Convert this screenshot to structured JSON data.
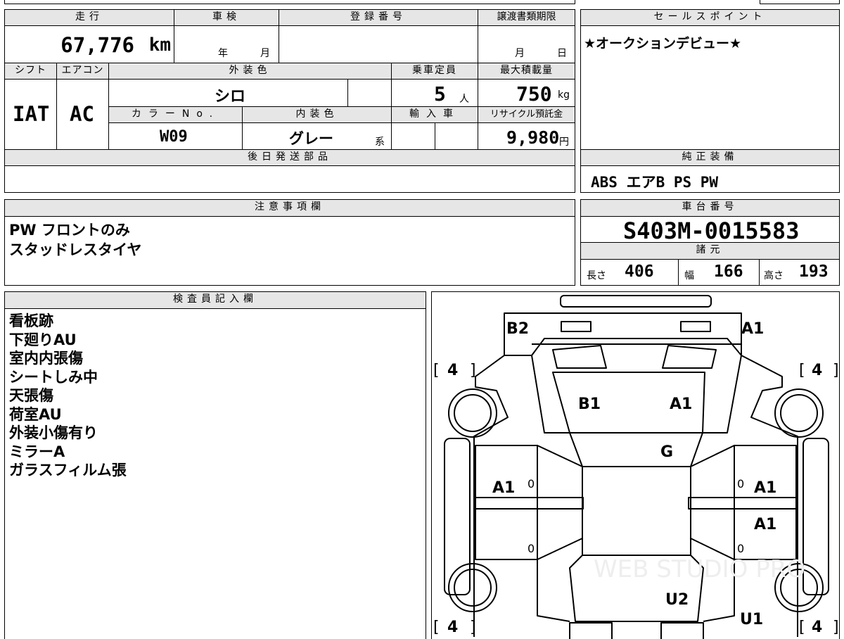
{
  "vehicle": {
    "mileage_label": "走行",
    "mileage_value": "67,776",
    "mileage_unit": "km",
    "inspection_label": "車検",
    "inspection_year_unit": "年",
    "inspection_month_unit": "月",
    "registration_label": "登録番号",
    "transfer_deadline_label": "譲渡書類期限",
    "transfer_month_unit": "月",
    "transfer_day_unit": "日",
    "shift_label": "シフト",
    "shift_value": "IAT",
    "aircon_label": "エアコン",
    "aircon_value": "AC",
    "exterior_color_label": "外装色",
    "exterior_color_value": "シロ",
    "capacity_label": "乗車定員",
    "capacity_value": "5",
    "capacity_unit": "人",
    "max_load_label": "最大積載量",
    "max_load_value": "750",
    "max_load_unit": "kg",
    "color_no_label": "カラーNo.",
    "color_no_value": "W09",
    "interior_color_label": "内装色",
    "interior_color_value": "グレー",
    "interior_color_suffix": "系",
    "import_label": "輸入車",
    "recycle_label": "リサイクル預託金",
    "recycle_value": "9,980",
    "recycle_unit": "円",
    "later_parts_label": "後日発送部品"
  },
  "sales": {
    "label": "セールスポイント",
    "text": "★オークションデビュー★"
  },
  "genuine": {
    "label": "純正装備",
    "text": "ABS エアB PS PW"
  },
  "notes": {
    "label": "注意事項欄",
    "lines": [
      "PW フロントのみ",
      "スタッドレスタイヤ"
    ]
  },
  "chassis": {
    "label": "車台番号",
    "value": "S403M-0015583",
    "spec_label": "諸元",
    "length_label": "長さ",
    "length_value": "406",
    "width_label": "幅",
    "width_value": "166",
    "height_label": "高さ",
    "height_value": "193"
  },
  "inspector": {
    "label": "検査員記入欄",
    "lines": [
      "看板跡",
      "下廻りAU",
      "室内内張傷",
      "シートしみ中",
      "天張傷",
      "荷室AU",
      "外装小傷有り",
      "ミラーA",
      "ガラスフィルム張"
    ]
  },
  "diagram": {
    "marks": [
      "B2",
      "A1",
      "B1",
      "A1",
      "G",
      "A1",
      "A1",
      "A1",
      "U2",
      "U1"
    ],
    "tires": [
      "4",
      "4",
      "4",
      "4"
    ],
    "zeros": [
      "0",
      "0",
      "0",
      "0"
    ],
    "watermark": "WEB STUDIO PRO"
  }
}
